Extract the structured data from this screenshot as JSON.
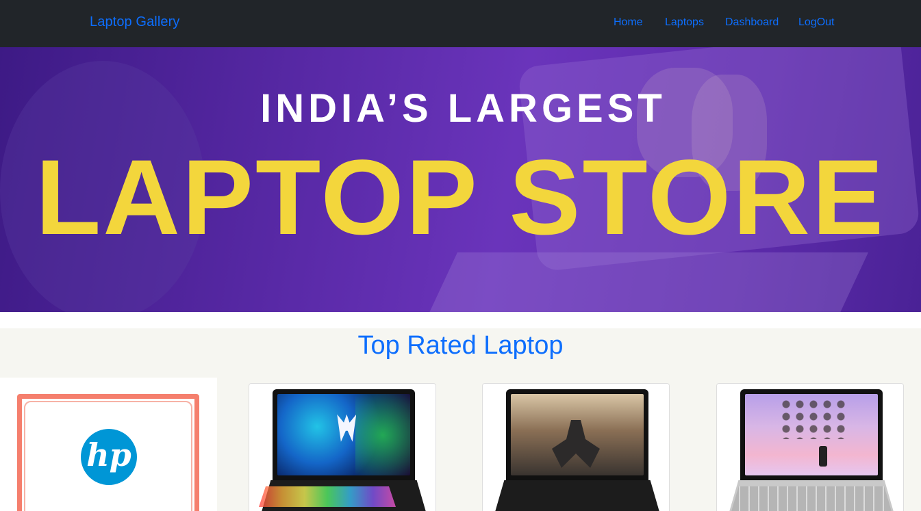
{
  "navbar": {
    "brand": "Laptop Gallery",
    "links": [
      {
        "label": "Home"
      },
      {
        "label": "Laptops"
      },
      {
        "label": "Dashboard"
      },
      {
        "label": "LogOut"
      }
    ]
  },
  "hero": {
    "top_line": "INDIA’S LARGEST",
    "main_line": "LAPTOP STORE"
  },
  "section": {
    "title": "Top Rated Laptop"
  },
  "colors": {
    "nav_bg": "#212529",
    "link": "#0d6efd",
    "hero_purple": "#5a2aa8",
    "hero_yellow": "#f3d63c"
  },
  "cards": [
    {
      "logo_text": "hp",
      "icon": "hp-logo"
    },
    {
      "icon": "gaming-laptop-image"
    },
    {
      "icon": "acer-laptop-image"
    },
    {
      "icon": "lenovo-laptop-image"
    }
  ]
}
